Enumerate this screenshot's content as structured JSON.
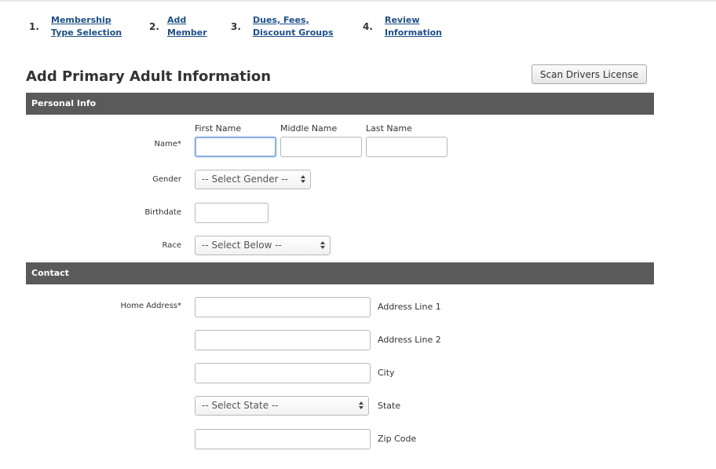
{
  "steps": [
    {
      "num": "1.",
      "line1": "Membership",
      "line2": "Type Selection"
    },
    {
      "num": "2.",
      "line1": "Add",
      "line2": "Member"
    },
    {
      "num": "3.",
      "line1": "Dues, Fees,",
      "line2": "Discount Groups"
    },
    {
      "num": "4.",
      "line1": "Review",
      "line2": "Information"
    }
  ],
  "page_title": "Add Primary Adult Information",
  "scan_button": "Scan Drivers License",
  "sections": {
    "personal": "Personal Info",
    "contact": "Contact"
  },
  "personal": {
    "name_columns": {
      "first": "First Name",
      "middle": "Middle Name",
      "last": "Last Name"
    },
    "name_label": "Name*",
    "gender_label": "Gender",
    "gender_value": "-- Select Gender --",
    "birthdate_label": "Birthdate",
    "race_label": "Race",
    "race_value": "-- Select Below --"
  },
  "contact": {
    "home_address_label": "Home Address*",
    "address_line1": "Address Line 1",
    "address_line2": "Address Line 2",
    "city": "City",
    "state_value": "-- Select State --",
    "state": "State",
    "zip": "Zip Code"
  }
}
